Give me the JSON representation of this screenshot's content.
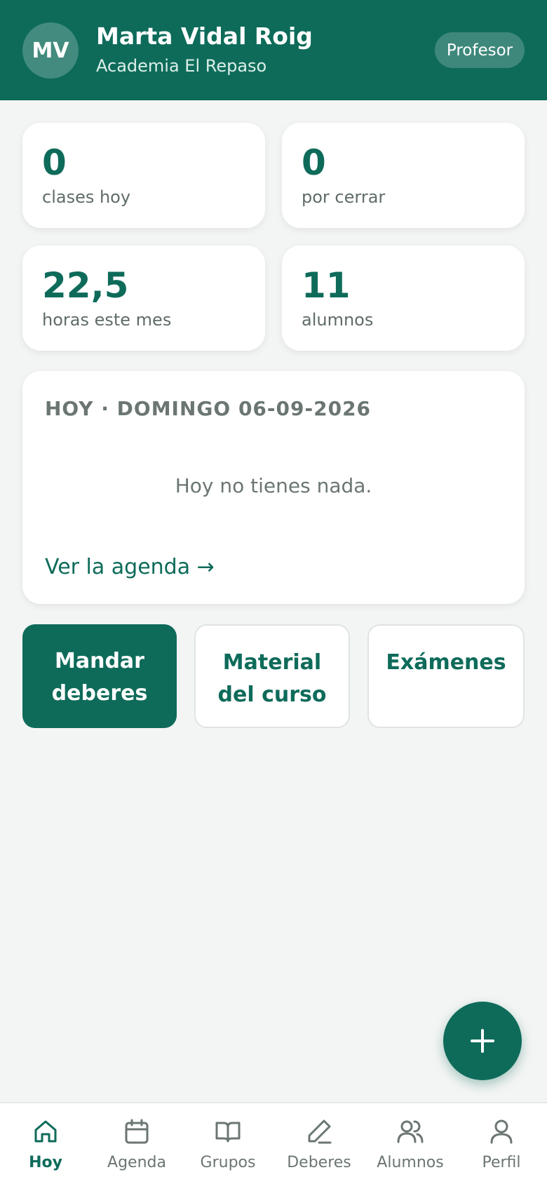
{
  "colors": {
    "brand": "#0e6b5a",
    "background": "#f3f5f4",
    "muted_text": "#6b7673"
  },
  "header": {
    "avatar_initials": "MV",
    "name": "Marta Vidal Roig",
    "organization": "Academia El Repaso",
    "role": "Profesor"
  },
  "stats": [
    {
      "value": "0",
      "label": "clases hoy"
    },
    {
      "value": "0",
      "label": "por cerrar"
    },
    {
      "value": "22,5",
      "label": "horas este mes"
    },
    {
      "value": "11",
      "label": "alumnos"
    }
  ],
  "today": {
    "title": "HOY · DOMINGO 06-09-2026",
    "empty_message": "Hoy no tienes nada.",
    "agenda_link": "Ver la agenda →"
  },
  "actions": [
    {
      "line1": "Mandar",
      "line2": "deberes"
    },
    {
      "line1": "Material",
      "line2": "del curso"
    },
    {
      "line1": "Exámenes",
      "line2": ""
    }
  ],
  "fab": {
    "icon": "plus-icon"
  },
  "nav": [
    {
      "label": "Hoy",
      "icon": "home-icon",
      "active": true
    },
    {
      "label": "Agenda",
      "icon": "calendar-icon",
      "active": false
    },
    {
      "label": "Grupos",
      "icon": "book-icon",
      "active": false
    },
    {
      "label": "Deberes",
      "icon": "pencil-icon",
      "active": false
    },
    {
      "label": "Alumnos",
      "icon": "users-icon",
      "active": false
    },
    {
      "label": "Perfil",
      "icon": "user-icon",
      "active": false
    }
  ]
}
